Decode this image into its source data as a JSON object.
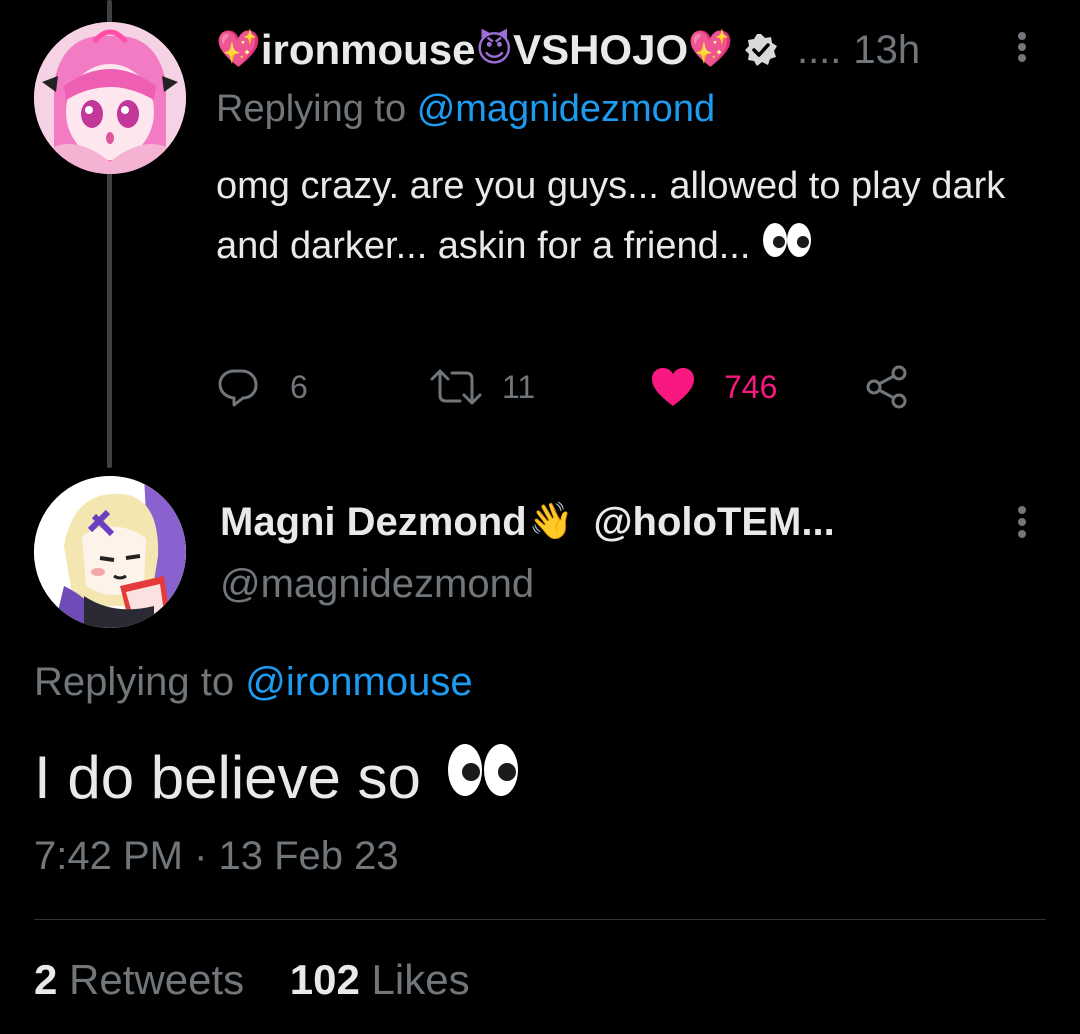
{
  "tweet1": {
    "display_name_prefix_emoji": "💖",
    "display_name_part1": "ironmouse",
    "display_name_emoji_mid": "😈",
    "display_name_part2": "VSHOJO",
    "display_name_suffix_emoji": "💖",
    "verified_icon": "verified-badge-icon",
    "separator": "....",
    "time_ago": "13h",
    "replying_to_label": "Replying to",
    "replying_to_handle": "@magnidezmond",
    "body_text": "omg crazy. are you guys... allowed to play dark and darker... askin for a friend...",
    "actions": {
      "reply_count": "6",
      "retweet_count": "11",
      "like_count": "746"
    }
  },
  "tweet2": {
    "display_name": "Magni Dezmond",
    "display_name_emoji": "👋",
    "display_name_suffix": "@holoTEM...",
    "handle": "@magnidezmond",
    "replying_to_label": "Replying to",
    "replying_to_handle": "@ironmouse",
    "body_text": "I do believe so",
    "timestamp": "7:42 PM · 13 Feb 23",
    "retweets_count": "2",
    "retweets_label": "Retweets",
    "likes_count": "102",
    "likes_label": "Likes"
  },
  "colors": {
    "background": "#000000",
    "text_primary": "#e7e9ea",
    "text_muted": "#71767b",
    "link": "#1d9bf0",
    "like": "#f91880"
  }
}
